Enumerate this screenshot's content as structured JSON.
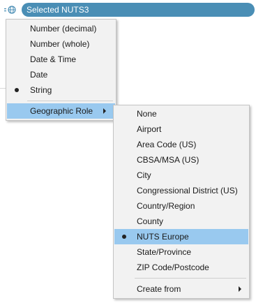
{
  "field_pill": {
    "icon": "globe-icon",
    "label": "Selected NUTS3"
  },
  "background_text": "n",
  "colors": {
    "pill": "#4a8eb5",
    "highlight": "#99c9ef",
    "menu_bg": "#f2f2f2"
  },
  "data_type_menu": {
    "items": [
      {
        "label": "Number (decimal)",
        "selected": false
      },
      {
        "label": "Number (whole)",
        "selected": false
      },
      {
        "label": "Date & Time",
        "selected": false
      },
      {
        "label": "Date",
        "selected": false
      },
      {
        "label": "String",
        "selected": true
      }
    ],
    "geographic_role": {
      "label": "Geographic Role",
      "has_submenu": true,
      "highlighted": true
    }
  },
  "geographic_role_menu": {
    "items": [
      {
        "label": "None",
        "selected": false
      },
      {
        "label": "Airport",
        "selected": false
      },
      {
        "label": "Area Code (US)",
        "selected": false
      },
      {
        "label": "CBSA/MSA (US)",
        "selected": false
      },
      {
        "label": "City",
        "selected": false
      },
      {
        "label": "Congressional District (US)",
        "selected": false
      },
      {
        "label": "Country/Region",
        "selected": false
      },
      {
        "label": "County",
        "selected": false
      },
      {
        "label": "NUTS Europe",
        "selected": true
      },
      {
        "label": "State/Province",
        "selected": false
      },
      {
        "label": "ZIP Code/Postcode",
        "selected": false
      }
    ],
    "create_from": {
      "label": "Create from",
      "has_submenu": true
    }
  }
}
